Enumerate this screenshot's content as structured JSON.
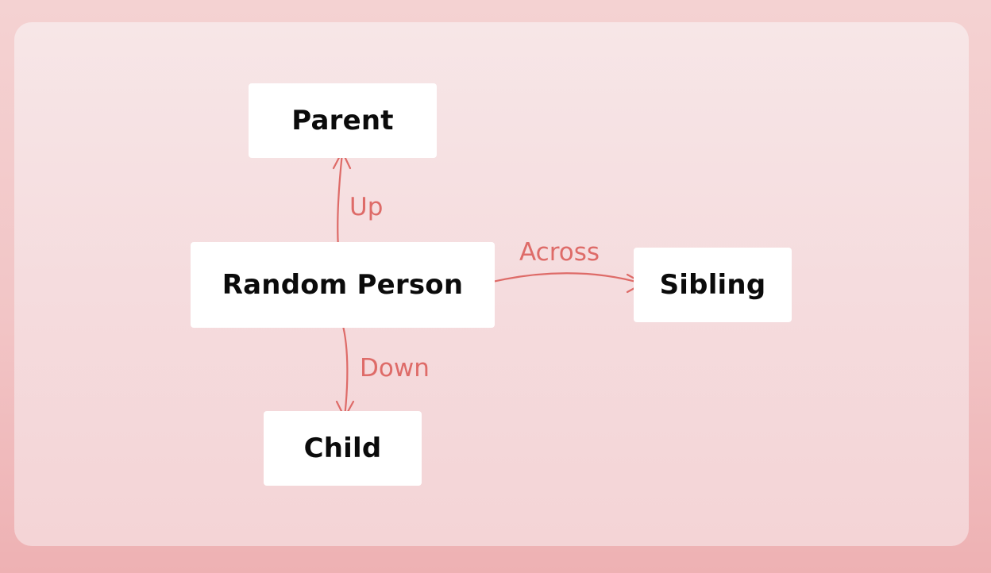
{
  "diagram": {
    "nodes": {
      "parent": "Parent",
      "random_person": "Random Person",
      "sibling": "Sibling",
      "child": "Child"
    },
    "edges": {
      "up": "Up",
      "across": "Across",
      "down": "Down"
    },
    "colors": {
      "edge": "#de6b68",
      "node_fill": "#ffffff",
      "node_text": "#0b0b0b"
    }
  }
}
